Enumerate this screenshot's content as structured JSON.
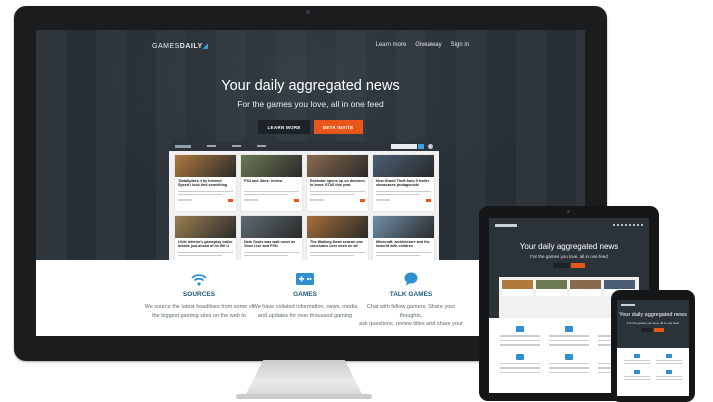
{
  "site": {
    "brand_prefix": "GAMES",
    "brand_suffix": "DAILY",
    "nav": [
      "Learn more",
      "Giveaway",
      "Sign in"
    ],
    "hero_title": "Your daily aggregated news",
    "hero_subtitle": "For the games you love, all in one feed",
    "learn_more_label": "LEARN MORE",
    "beta_invite_label": "BETA INVITE"
  },
  "preview_cards": [
    {
      "title": "'DataSpikes 4 by Interect' Speed I look find something",
      "color": "#b07a3e"
    },
    {
      "title": "PS4 and Xbox: review",
      "color": "#6b7a52"
    },
    {
      "title": "Rockstar opens up on decision to leave GTA5 this year",
      "color": "#8a6a4e"
    },
    {
      "title": "New Grand Theft Auto 5 trailer showcases protagonists",
      "color": "#4a5f76"
    },
    {
      "title": "Little Inferno's gameplay trailer details just ahead of its Wii U launch",
      "color": "#9c8050"
    },
    {
      "title": "Dark Souls was wait novel as Xbox Live and PSN",
      "color": "#5e6b70"
    },
    {
      "title": "The Walking Dead season one concludes next week on all platforms",
      "color": "#a56f3a"
    },
    {
      "title": "Minecraft, architecture and the inworld with children",
      "color": "#6f8fa8"
    }
  ],
  "features": [
    {
      "icon": "wifi-icon",
      "title": "SOURCES",
      "desc_1": "We source the latest headlines from some of",
      "desc_2": "the biggest gaming sites on the web to"
    },
    {
      "icon": "gamepad-icon",
      "title": "GAMES",
      "desc_1": "We have collated information, news, media",
      "desc_2": "and updates for over thousand gaming"
    },
    {
      "icon": "chat-icon",
      "title": "TALK GAMES",
      "desc_1": "Chat with fellow gamers. Share your thoughts,",
      "desc_2": "ask questions, review titles and share your"
    }
  ],
  "tablet": {
    "hero_title": "Your daily aggregated news",
    "hero_subtitle": "For the games you love, all in one feed"
  },
  "phone": {
    "hero_title": "Your daily aggregated news",
    "hero_subtitle": "For the games you love, all in one feed"
  },
  "colors": {
    "accent": "#e9561b",
    "brand_blue": "#3aa3e3",
    "dark": "#2b3238",
    "feature_heading": "#1f5a7c"
  }
}
